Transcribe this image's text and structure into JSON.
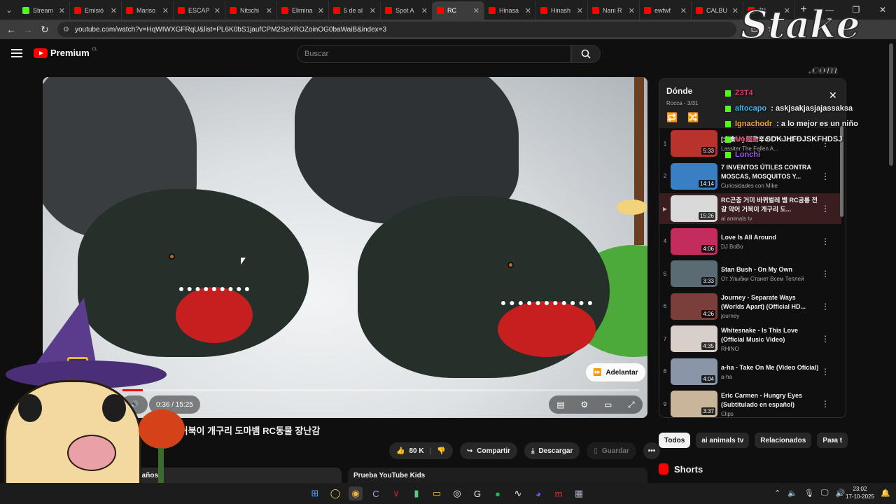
{
  "browser": {
    "tabs": [
      {
        "label": "Stream",
        "color": "#53fc18"
      },
      {
        "label": "Emisió",
        "color": "#ff0000"
      },
      {
        "label": "Mariso",
        "color": "#ff0000"
      },
      {
        "label": "ESCAP",
        "color": "#ff0000"
      },
      {
        "label": "Nitschi",
        "color": "#ff0000"
      },
      {
        "label": "Elimina",
        "color": "#ff0000"
      },
      {
        "label": "5 de al",
        "color": "#ff0000"
      },
      {
        "label": "Spot A",
        "color": "#ff0000"
      },
      {
        "label": "RC",
        "color": "#ff0000",
        "active": true
      },
      {
        "label": "Hinasa",
        "color": "#ff0000"
      },
      {
        "label": "Hinash",
        "color": "#ff0000"
      },
      {
        "label": "Nani R",
        "color": "#ff0000"
      },
      {
        "label": "ewfwf",
        "color": "#ff0000"
      },
      {
        "label": "CALBU",
        "color": "#ff0000"
      },
      {
        "label": "JN",
        "color": "#ff0000"
      }
    ],
    "url": "youtube.com/watch?v=HqWIWXGFRqU&list=PL6K0bS1jaufCPM2SeXROZoinOG0baWaiB&index=3"
  },
  "youtube": {
    "logo": "Premium",
    "region": "CL",
    "search_placeholder": "Buscar",
    "skip_label": "Adelantar",
    "time": "0:36 / 15:25",
    "progress_fraction": 0.039,
    "video_title": "뱀 전갈 악어 거북이 개구리 도마뱀 RC동물 장난감",
    "actions": {
      "likes": "80 K",
      "share": "Compartir",
      "download": "Descargar",
      "save": "Guardar"
    },
    "desc_snippet": "e 7 años",
    "kids_banner": "Prueba YouTube Kids"
  },
  "playlist": {
    "title": "Dónde",
    "sub": "Rocca - 3/31",
    "items": [
      {
        "idx": "1",
        "title": "[大食い] 超激辛のジーンズー",
        "channel": "Lassiter The Fallen A...",
        "dur": "5:33",
        "color": "#b8332b"
      },
      {
        "idx": "2",
        "title": "7 INVENTOS ÚTILES CONTRA MOSCAS, MOSQUITOS Y...",
        "channel": "Curiosidades con Mike",
        "dur": "14:14",
        "color": "#3a7fc4"
      },
      {
        "idx": "▶",
        "title": "RC곤충 거미 바퀴벌레 뱀 RC공룡 전갈 악어 거북이 개구리 도...",
        "channel": "ai animals tv",
        "dur": "15:26",
        "color": "#d9d9d9"
      },
      {
        "idx": "4",
        "title": "Love Is All Around",
        "channel": "DJ BoBo",
        "dur": "4:06",
        "color": "#c52c5e"
      },
      {
        "idx": "5",
        "title": "Stan Bush - On My Own",
        "channel": "От Улыбки Станет Всем Теплей",
        "dur": "3:33",
        "color": "#5a6b73"
      },
      {
        "idx": "6",
        "title": "Journey - Separate Ways (Worlds Apart) (Official HD...",
        "channel": "journey",
        "dur": "4:26",
        "color": "#7a3f3a"
      },
      {
        "idx": "7",
        "title": "Whitesnake - Is This Love (Official Music Video)",
        "channel": "RHINO",
        "dur": "4:35",
        "color": "#d8d0c8"
      },
      {
        "idx": "8",
        "title": "a-ha - Take On Me (Video Oficial)",
        "channel": "a-ha",
        "dur": "4:04",
        "color": "#8b95a8"
      },
      {
        "idx": "9",
        "title": "Eric Carmen - Hungry Eyes (Subtitulado en español)",
        "channel": "Clips",
        "dur": "3:37",
        "color": "#c9b59a"
      }
    ]
  },
  "chips": [
    "Todos",
    "ai animals tv",
    "Relacionados",
    "Para t"
  ],
  "shorts_label": "Shorts",
  "chat": [
    {
      "user": "Z3T4",
      "text": "",
      "color": "#e0396a"
    },
    {
      "user": "altocapo",
      "text": ": askjsakjasjajassaksa",
      "color": "#3fb6e8"
    },
    {
      "user": "Ignachodr",
      "text": ": a lo mejor es un niño",
      "color": "#f0a830"
    },
    {
      "user": "NoXia",
      "text": ": SDKJHFDJSKFHDSJ",
      "color": "#e0396a"
    },
    {
      "user": "Lonchi",
      "text": "",
      "color": "#9b59e8"
    }
  ],
  "overlay_brand": {
    "word": "Stake",
    "suffix": ".com"
  },
  "taskbar": {
    "time": "23:02",
    "date": "17-10-2025"
  }
}
